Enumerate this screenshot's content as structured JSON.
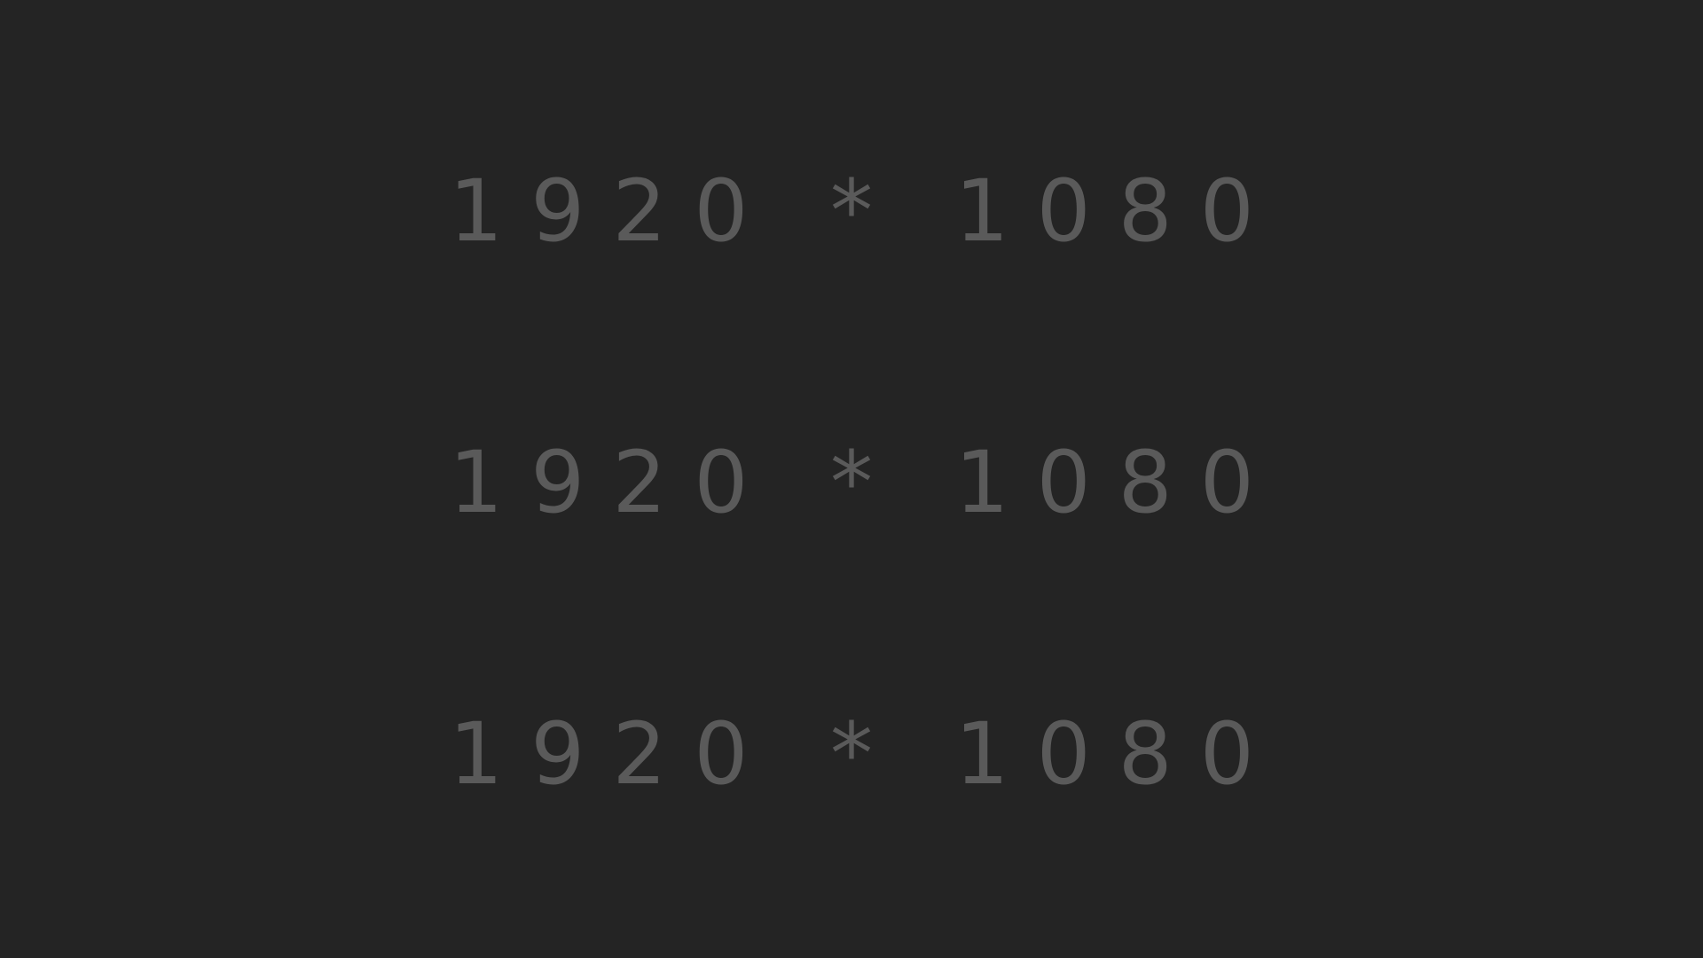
{
  "background_color": "#242424",
  "text_color": "#5a5a5a",
  "lines": [
    "1920 * 1080",
    "1920 * 1080",
    "1920 * 1080"
  ]
}
